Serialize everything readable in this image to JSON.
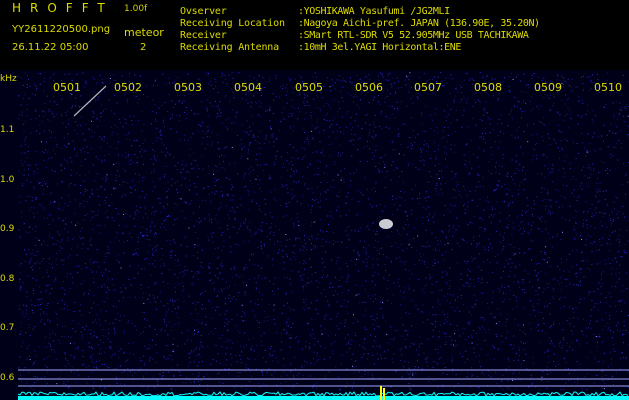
{
  "header": {
    "app_title": "HROFFT",
    "version": "1.00f",
    "file_name": "YY2611220500.png",
    "timestamp": "26.11.22 05:00",
    "meteor_label": "meteor",
    "meteor_count": "2"
  },
  "info": [
    {
      "label": "Ovserver",
      "value": ":YOSHIKAWA Yasufumi /JG2MLI"
    },
    {
      "label": "Receiving Location",
      "value": ":Nagoya Aichi-pref. JAPAN (136.90E, 35.20N)"
    },
    {
      "label": "Receiver",
      "value": ":SMart RTL-SDR V5 52.905MHz USB TACHIKAWA"
    },
    {
      "label": "Receiving Antenna",
      "value": ":10mH 3el.YAGI Horizontal:ENE"
    }
  ],
  "axis": {
    "unit": "kHz",
    "time_labels": [
      "0501",
      "0502",
      "0503",
      "0504",
      "0505",
      "0506",
      "0507",
      "0508",
      "0509",
      "0510"
    ],
    "freq_labels": [
      "1.1",
      "1.0",
      "0.9",
      "0.8",
      "0.7",
      "0.6"
    ]
  },
  "colors": {
    "text": "#dcdc00",
    "noise": "#2b2bd0",
    "signal": "#ffffff",
    "baseline": "#00ffff",
    "burst": "#ffff00",
    "guide_line": "#9fa6ff"
  }
}
